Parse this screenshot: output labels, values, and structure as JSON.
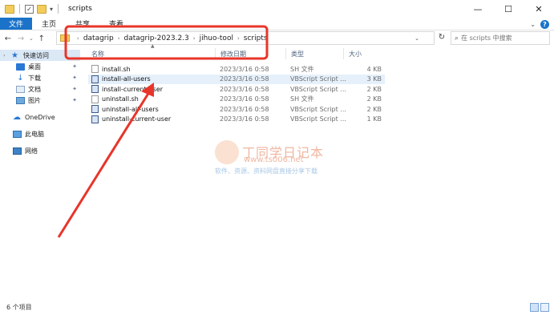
{
  "window": {
    "title": "scripts",
    "controls": [
      "—",
      "☐",
      "✕"
    ]
  },
  "ribbon": {
    "tabs": [
      "文件",
      "主页",
      "共享",
      "查看"
    ]
  },
  "address": {
    "crumbs": [
      "datagrip",
      "datagrip-2023.2.3",
      "jihuo-tool",
      "scripts"
    ],
    "search_placeholder": "在 scripts 中搜索"
  },
  "nav_pane": {
    "quick_access": "快速访问",
    "quick_items": [
      {
        "label": "桌面",
        "icon": "desktop-icon"
      },
      {
        "label": "下载",
        "icon": "download-icon"
      },
      {
        "label": "文档",
        "icon": "document-icon"
      },
      {
        "label": "图片",
        "icon": "picture-icon"
      }
    ],
    "onedrive": "OneDrive",
    "this_pc": "此电脑",
    "network": "网络"
  },
  "file_list": {
    "columns": [
      "名称",
      "修改日期",
      "类型",
      "大小"
    ],
    "rows": [
      {
        "name": "install.sh",
        "date": "2023/3/16 0:58",
        "type": "SH 文件",
        "size": "4 KB",
        "icon": "sh-file-icon"
      },
      {
        "name": "install-all-users",
        "date": "2023/3/16 0:58",
        "type": "VBScript Script ...",
        "size": "3 KB",
        "icon": "vbscript-file-icon",
        "selected": true
      },
      {
        "name": "install-current-user",
        "date": "2023/3/16 0:58",
        "type": "VBScript Script ...",
        "size": "2 KB",
        "icon": "vbscript-file-icon"
      },
      {
        "name": "uninstall.sh",
        "date": "2023/3/16 0:58",
        "type": "SH 文件",
        "size": "2 KB",
        "icon": "sh-file-icon"
      },
      {
        "name": "uninstall-all-users",
        "date": "2023/3/16 0:58",
        "type": "VBScript Script ...",
        "size": "2 KB",
        "icon": "vbscript-file-icon"
      },
      {
        "name": "uninstall-current-user",
        "date": "2023/3/16 0:58",
        "type": "VBScript Script ...",
        "size": "1 KB",
        "icon": "vbscript-file-icon"
      }
    ]
  },
  "watermark": {
    "title": "丁同学日记本",
    "url": "www.ts006.net",
    "subtitle": "软件、资源、资料网盘直接分享下载"
  },
  "status": {
    "item_count": "6 个项目"
  },
  "colors": {
    "accent": "#1a73c9",
    "annotation_red": "#e8352a",
    "selection": "#e5f0fb"
  }
}
